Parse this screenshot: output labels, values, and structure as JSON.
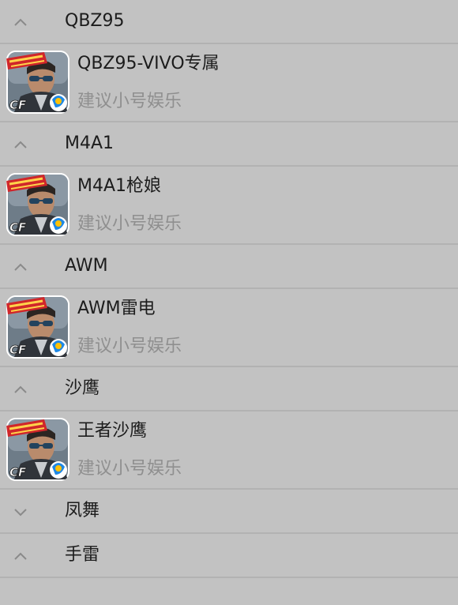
{
  "colors": {
    "background": "#c2c2c2",
    "divider": "#b2b2b2",
    "title_text": "#1c1c1c",
    "subtitle_text": "#8f8f8f",
    "chevron": "#8a8a8a"
  },
  "groups": [
    {
      "title": "QBZ95",
      "expanded": true,
      "chevron_icon": "chevron-up-icon",
      "items": [
        {
          "title": "QBZ95-VIVO专属",
          "subtitle": "建议小号娱乐",
          "icon": "game-app-icon"
        }
      ]
    },
    {
      "title": "M4A1",
      "expanded": true,
      "chevron_icon": "chevron-up-icon",
      "items": [
        {
          "title": "M4A1枪娘",
          "subtitle": "建议小号娱乐",
          "icon": "game-app-icon"
        }
      ]
    },
    {
      "title": "AWM",
      "expanded": true,
      "chevron_icon": "chevron-up-icon",
      "items": [
        {
          "title": "AWM雷电",
          "subtitle": "建议小号娱乐",
          "icon": "game-app-icon"
        }
      ]
    },
    {
      "title": "沙鹰",
      "expanded": true,
      "chevron_icon": "chevron-up-icon",
      "items": [
        {
          "title": "王者沙鹰",
          "subtitle": "建议小号娱乐",
          "icon": "game-app-icon"
        }
      ]
    },
    {
      "title": "凤舞",
      "expanded": false,
      "chevron_icon": "chevron-down-icon",
      "items": []
    },
    {
      "title": "手雷",
      "expanded": true,
      "chevron_icon": "chevron-up-icon",
      "items": []
    }
  ]
}
